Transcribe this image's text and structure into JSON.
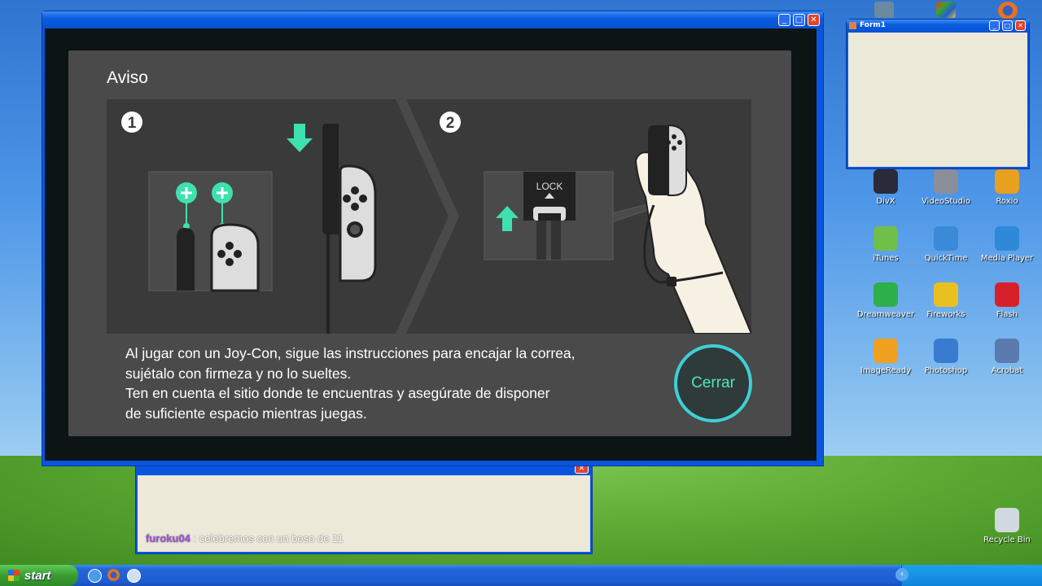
{
  "switch_dialog": {
    "title": "Aviso",
    "step1_number": "1",
    "step2_number": "2",
    "lock_label": "LOCK",
    "message_lines": [
      "Al jugar con un Joy-Con, sigue las instrucciones para encajar la correa,",
      "sujétalo con firmeza y no lo sueltes.",
      "Ten en cuenta el sitio donde te encuentras y asegúrate de disponer",
      "de suficiente espacio mientras juegas."
    ],
    "close_label": "Cerrar"
  },
  "form1": {
    "title": "Form1"
  },
  "chat": {
    "username": "furoku04",
    "message": " : celebremos con un beso de 11"
  },
  "desktop_icons": [
    {
      "label": "DivX",
      "color": "#2a2a3a"
    },
    {
      "label": "VideoStudio",
      "color": "#8a8f9a"
    },
    {
      "label": "Roxio",
      "color": "#e8a020"
    },
    {
      "label": "iTunes",
      "color": "#6fbf4a"
    },
    {
      "label": "QuickTime",
      "color": "#3a8ad8"
    },
    {
      "label": "Media Player",
      "color": "#2e8ad8"
    },
    {
      "label": "Dreamweaver",
      "color": "#2db04a"
    },
    {
      "label": "Fireworks",
      "color": "#e8c020"
    },
    {
      "label": "Flash",
      "color": "#d8202a"
    },
    {
      "label": "ImageReady",
      "color": "#f0a020"
    },
    {
      "label": "Photoshop",
      "color": "#3a7ad0"
    },
    {
      "label": "Acrobat",
      "color": "#5a7ab0"
    },
    {
      "label": "Recycle Bin",
      "color": "#d0d8e0"
    }
  ],
  "taskbar": {
    "start_label": "start"
  },
  "colors": {
    "accent": "#3fd0d6",
    "joycon_green": "#3fe0b0",
    "xp_blue": "#0a55e0"
  }
}
